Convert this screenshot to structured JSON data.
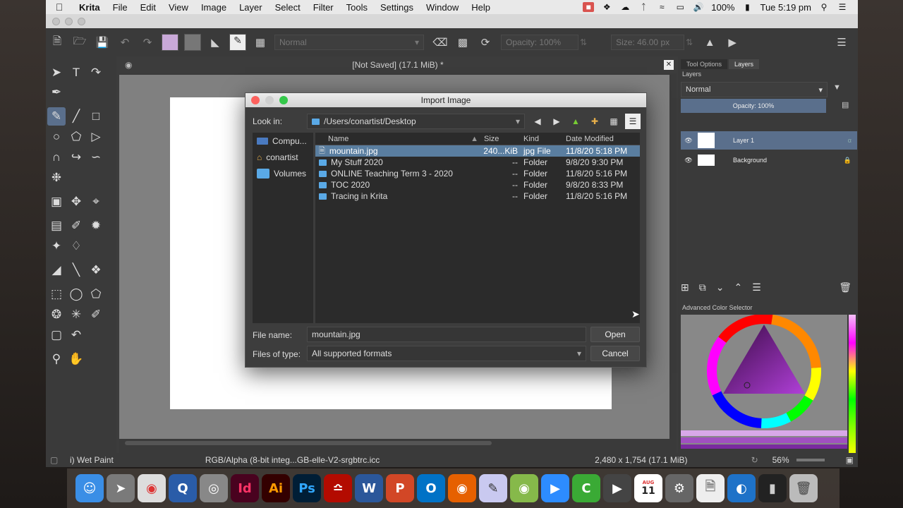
{
  "menubar": {
    "app": "Krita",
    "items": [
      "File",
      "Edit",
      "View",
      "Image",
      "Layer",
      "Select",
      "Filter",
      "Tools",
      "Settings",
      "Window",
      "Help"
    ],
    "battery": "100%",
    "clock": "Tue 5:19 pm"
  },
  "toolbar": {
    "blend_mode": "Normal",
    "opacity": "Opacity: 100%",
    "size": "Size: 46.00 px"
  },
  "document": {
    "title": "[Not Saved]  (17.1 MiB) *"
  },
  "docker": {
    "tabs": [
      "Tool Options",
      "Layers"
    ],
    "panel_title": "Layers",
    "blend_mode": "Normal",
    "opacity": "Opacity:  100%",
    "layers": [
      "Layer 1",
      "Background"
    ],
    "color_selector_title": "Advanced Color Selector"
  },
  "status": {
    "brush": "i) Wet Paint",
    "color_profile": "RGB/Alpha (8-bit integ...GB-elle-V2-srgbtrc.icc",
    "dimensions": "2,480 x 1,754 (17.1 MiB)",
    "zoom": "56%"
  },
  "dialog": {
    "title": "Import Image",
    "look_in_label": "Look in:",
    "path": "/Users/conartist/Desktop",
    "places": [
      "Compu...",
      "conartist",
      "Volumes"
    ],
    "columns": [
      "Name",
      "Size",
      "Kind",
      "Date Modified"
    ],
    "files": [
      {
        "name": "mountain.jpg",
        "size": "240...KiB",
        "kind": "jpg File",
        "date": "11/8/20 5:18 PM",
        "selected": true
      },
      {
        "name": "My Stuff 2020",
        "size": "--",
        "kind": "Folder",
        "date": "9/8/20 9:30 PM",
        "selected": false
      },
      {
        "name": "ONLINE Teaching Term 3 - 2020",
        "size": "--",
        "kind": "Folder",
        "date": "11/8/20 5:16 PM",
        "selected": false
      },
      {
        "name": "TOC 2020",
        "size": "--",
        "kind": "Folder",
        "date": "9/8/20 8:33 PM",
        "selected": false
      },
      {
        "name": "Tracing in Krita",
        "size": "--",
        "kind": "Folder",
        "date": "11/8/20 5:16 PM",
        "selected": false
      }
    ],
    "file_name_label": "File name:",
    "file_name": "mountain.jpg",
    "files_of_type_label": "Files of type:",
    "files_of_type": "All supported formats",
    "open_label": "Open",
    "cancel_label": "Cancel"
  },
  "dock": {
    "calendar_month": "AUG",
    "calendar_day": "11",
    "apps": [
      "Finder",
      "Launchpad",
      "Chrome",
      "QuickTime",
      "Screenshot",
      "InDesign",
      "Illustrator",
      "Photoshop",
      "Acrobat",
      "Word",
      "PowerPoint",
      "Outlook",
      "Firefox",
      "Krita",
      "Android File Transfer",
      "Zoom",
      "Camtasia",
      "Elgato",
      "Calendar",
      "System Preferences",
      "Document",
      "Globe",
      "Terminal",
      "Trash"
    ],
    "labels": {
      "indesign": "Id",
      "illustrator": "Ai",
      "photoshop": "Ps",
      "word": "W",
      "powerpoint": "P",
      "outlook": "O"
    }
  }
}
